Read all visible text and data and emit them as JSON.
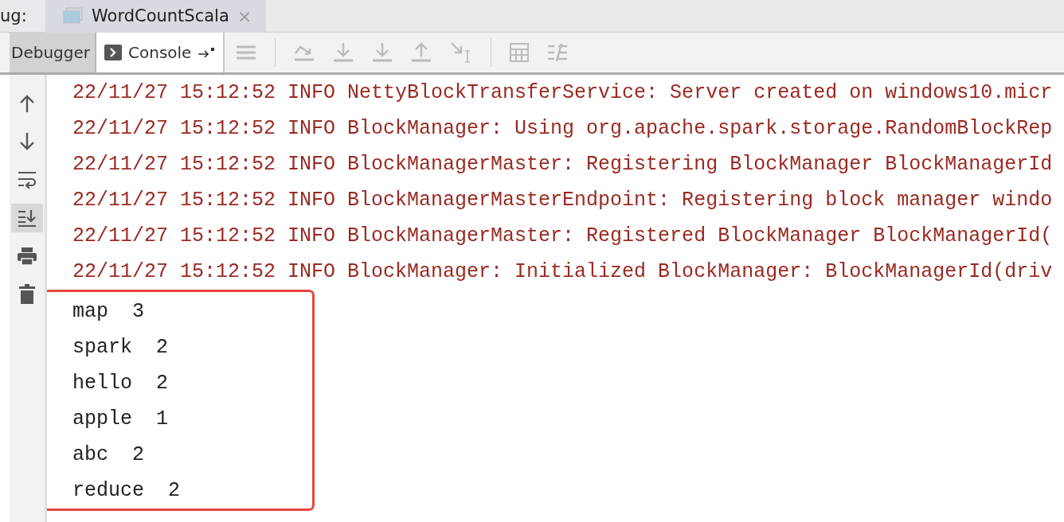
{
  "run_label": "ug:",
  "file_tab": {
    "title": "WordCountScala",
    "close": "×"
  },
  "tabs": [
    {
      "label": "Debugger",
      "selected": false
    },
    {
      "label": "Console",
      "selected": true
    }
  ],
  "gutter_tools": [
    {
      "kind": "up",
      "on": false
    },
    {
      "kind": "down",
      "on": false
    },
    {
      "kind": "wrap",
      "on": false
    },
    {
      "kind": "scroll-end",
      "on": true
    },
    {
      "kind": "print",
      "on": false
    },
    {
      "kind": "trash",
      "on": false
    }
  ],
  "log_lines": [
    "22/11/27 15:12:52 INFO NettyBlockTransferService: Server created on windows10.micr",
    "22/11/27 15:12:52 INFO BlockManager: Using org.apache.spark.storage.RandomBlockRep",
    "22/11/27 15:12:52 INFO BlockManagerMaster: Registering BlockManager BlockManagerId",
    "22/11/27 15:12:52 INFO BlockManagerMasterEndpoint: Registering block manager windo",
    "22/11/27 15:12:52 INFO BlockManagerMaster: Registered BlockManager BlockManagerId(",
    "22/11/27 15:12:52 INFO BlockManager: Initialized BlockManager: BlockManagerId(driv"
  ],
  "output_lines": [
    "map  3",
    "spark  2",
    "hello  2",
    "apple  1",
    "abc  2",
    "reduce  2"
  ]
}
